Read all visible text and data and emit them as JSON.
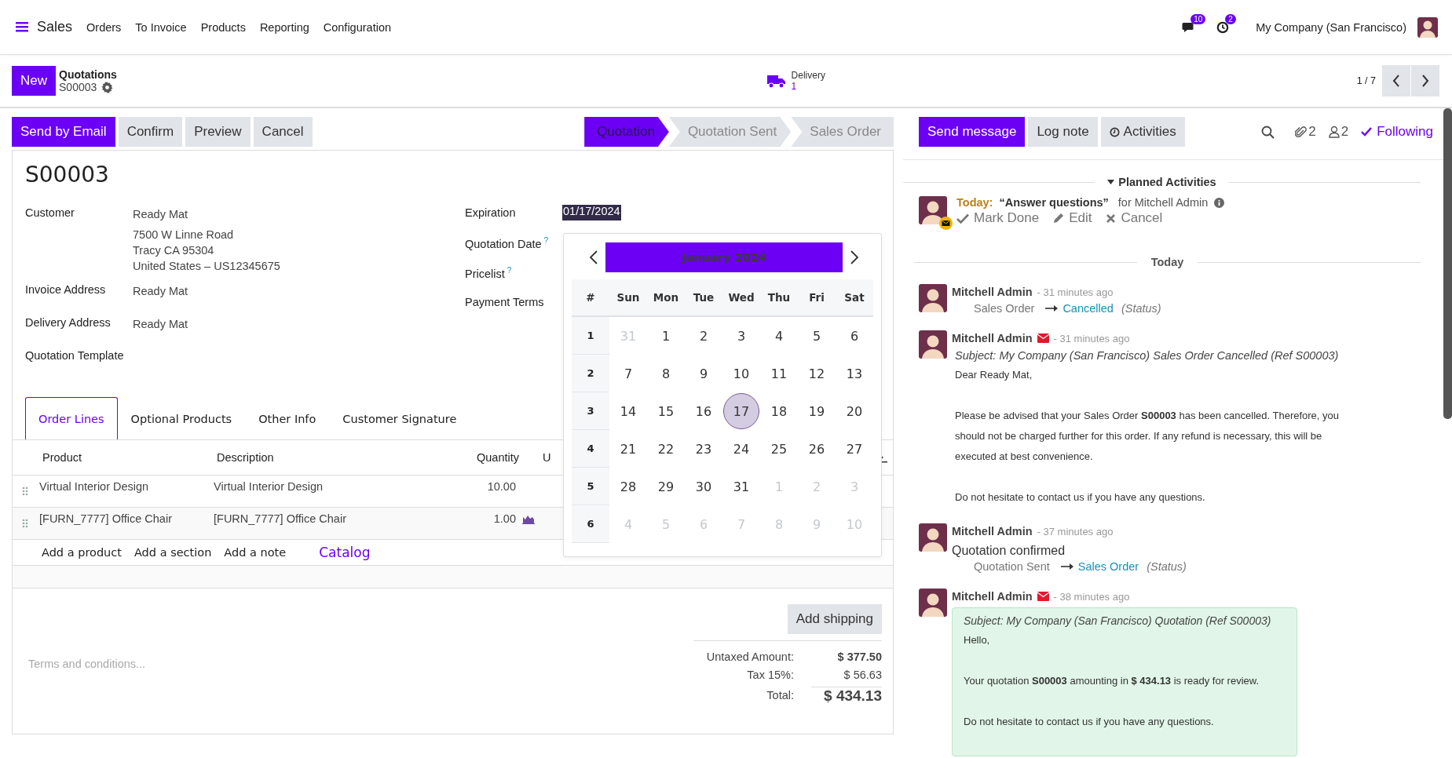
{
  "navbar": {
    "app": "Sales",
    "menu": [
      "Orders",
      "To Invoice",
      "Products",
      "Reporting",
      "Configuration"
    ],
    "messages_badge": "10",
    "activities_badge": "2",
    "company": "My Company (San Francisco)"
  },
  "control_panel": {
    "new_button": "New",
    "breadcrumb": "Quotations",
    "record": "S00003",
    "smart_button": {
      "label": "Delivery",
      "count": "1"
    },
    "pager": "1 / 7"
  },
  "actions": [
    {
      "label": "Send by Email",
      "primary": true
    },
    {
      "label": "Confirm",
      "primary": false
    },
    {
      "label": "Preview",
      "primary": false
    },
    {
      "label": "Cancel",
      "primary": false
    }
  ],
  "statusbar": [
    {
      "label": "Quotation",
      "selected": true
    },
    {
      "label": "Quotation Sent",
      "selected": false
    },
    {
      "label": "Sales Order",
      "selected": false
    }
  ],
  "form": {
    "title": "S00003",
    "left_fields": [
      {
        "label": "Customer",
        "lines": [
          "Ready Mat",
          "7500 W Linne Road",
          "Tracy CA 95304",
          "United States – US12345675"
        ]
      },
      {
        "label": "Invoice Address",
        "lines": [
          "Ready Mat"
        ]
      },
      {
        "label": "Delivery Address",
        "lines": [
          "Ready Mat"
        ]
      },
      {
        "label": "Quotation Template"
      }
    ],
    "right_fields": [
      {
        "label": "Expiration",
        "value": "01/17/2024"
      },
      {
        "label": "Quotation Date",
        "help": "?"
      },
      {
        "label": "Pricelist",
        "help": "?"
      },
      {
        "label": "Payment Terms"
      }
    ],
    "tabs": [
      {
        "label": "Order Lines",
        "selected": true
      },
      {
        "label": "Optional Products",
        "selected": false
      },
      {
        "label": "Other Info",
        "selected": false
      },
      {
        "label": "Customer Signature",
        "selected": false
      }
    ],
    "table": {
      "columns": [
        "Product",
        "Description",
        "Quantity",
        "U"
      ],
      "rows": [
        {
          "product": "Virtual Interior Design",
          "description": "Virtual Interior Design",
          "quantity": "10.00",
          "forecast": false
        },
        {
          "product": "[FURN_7777] Office Chair",
          "description": "[FURN_7777] Office Chair",
          "quantity": "1.00",
          "forecast": true
        }
      ],
      "add_links": [
        "Add a product",
        "Add a section",
        "Add a note"
      ],
      "catalog": "Catalog"
    },
    "terms_placeholder": "Terms and conditions...",
    "add_shipping": "Add shipping",
    "totals": [
      {
        "label": "Untaxed Amount:",
        "value": "$ 377.50",
        "kind": "bold"
      },
      {
        "label": "Tax 15%:",
        "value": "$ 56.63",
        "kind": "plain"
      },
      {
        "label": "Total:",
        "value": "$ 434.13",
        "kind": "grand"
      }
    ]
  },
  "datepicker": {
    "month": "January 2024",
    "weekdays": [
      "#",
      "Sun",
      "Mon",
      "Tue",
      "Wed",
      "Thu",
      "Fri",
      "Sat"
    ],
    "weeks": [
      {
        "number": "1",
        "days": [
          {
            "label": "31",
            "muted": true,
            "selected": false
          },
          {
            "label": "1",
            "muted": false,
            "selected": false
          },
          {
            "label": "2",
            "muted": false,
            "selected": false
          },
          {
            "label": "3",
            "muted": false,
            "selected": false
          },
          {
            "label": "4",
            "muted": false,
            "selected": false
          },
          {
            "label": "5",
            "muted": false,
            "selected": false
          },
          {
            "label": "6",
            "muted": false,
            "selected": false
          }
        ]
      },
      {
        "number": "2",
        "days": [
          {
            "label": "7",
            "muted": false,
            "selected": false
          },
          {
            "label": "8",
            "muted": false,
            "selected": false
          },
          {
            "label": "9",
            "muted": false,
            "selected": false
          },
          {
            "label": "10",
            "muted": false,
            "selected": false
          },
          {
            "label": "11",
            "muted": false,
            "selected": false
          },
          {
            "label": "12",
            "muted": false,
            "selected": false
          },
          {
            "label": "13",
            "muted": false,
            "selected": false
          }
        ]
      },
      {
        "number": "3",
        "days": [
          {
            "label": "14",
            "muted": false,
            "selected": false
          },
          {
            "label": "15",
            "muted": false,
            "selected": false
          },
          {
            "label": "16",
            "muted": false,
            "selected": false
          },
          {
            "label": "17",
            "muted": false,
            "selected": true
          },
          {
            "label": "18",
            "muted": false,
            "selected": false
          },
          {
            "label": "19",
            "muted": false,
            "selected": false
          },
          {
            "label": "20",
            "muted": false,
            "selected": false
          }
        ]
      },
      {
        "number": "4",
        "days": [
          {
            "label": "21",
            "muted": false,
            "selected": false
          },
          {
            "label": "22",
            "muted": false,
            "selected": false
          },
          {
            "label": "23",
            "muted": false,
            "selected": false
          },
          {
            "label": "24",
            "muted": false,
            "selected": false
          },
          {
            "label": "25",
            "muted": false,
            "selected": false
          },
          {
            "label": "26",
            "muted": false,
            "selected": false
          },
          {
            "label": "27",
            "muted": false,
            "selected": false
          }
        ]
      },
      {
        "number": "5",
        "days": [
          {
            "label": "28",
            "muted": false,
            "selected": false
          },
          {
            "label": "29",
            "muted": false,
            "selected": false
          },
          {
            "label": "30",
            "muted": false,
            "selected": false
          },
          {
            "label": "31",
            "muted": false,
            "selected": false
          },
          {
            "label": "1",
            "muted": true,
            "selected": false
          },
          {
            "label": "2",
            "muted": true,
            "selected": false
          },
          {
            "label": "3",
            "muted": true,
            "selected": false
          }
        ]
      },
      {
        "number": "6",
        "days": [
          {
            "label": "4",
            "muted": true,
            "selected": false
          },
          {
            "label": "5",
            "muted": true,
            "selected": false
          },
          {
            "label": "6",
            "muted": true,
            "selected": false
          },
          {
            "label": "7",
            "muted": true,
            "selected": false
          },
          {
            "label": "8",
            "muted": true,
            "selected": false
          },
          {
            "label": "9",
            "muted": true,
            "selected": false
          },
          {
            "label": "10",
            "muted": true,
            "selected": false
          }
        ]
      }
    ]
  },
  "chatter": {
    "buttons": [
      {
        "label": "Send message",
        "primary": true
      },
      {
        "label": "Log note",
        "primary": false
      },
      {
        "label": "Activities",
        "primary": false
      }
    ],
    "attachments": "2",
    "followers": "2",
    "follow": "Following",
    "planned_header": "Planned Activities",
    "activity": {
      "due": "Today:",
      "summary": "“Answer questions”",
      "assignee": "for Mitchell Admin",
      "actions": [
        {
          "label": "Mark Done",
          "kind": "done"
        },
        {
          "label": "Edit",
          "kind": "edit"
        },
        {
          "label": "Cancel",
          "kind": "cancel"
        }
      ]
    },
    "date_separator": "Today",
    "messages": [
      {
        "author": "Mitchell Admin",
        "email": false,
        "time": "- 31 minutes ago",
        "tracking": {
          "old": "Sales Order",
          "new": "Cancelled",
          "field": "(Status)"
        }
      },
      {
        "author": "Mitchell Admin",
        "email": true,
        "time": "- 31 minutes ago",
        "subject": "Subject: My Company (San Francisco) Sales Order Cancelled (Ref S00003)",
        "bubble": false,
        "paragraphs": [
          "Dear Ready Mat,",
          "Please be advised that your Sales Order **S00003** has been cancelled. Therefore, you should not be charged further for this order. If any refund is necessary, this will be executed at best convenience.",
          "Do not hesitate to contact us if you have any questions."
        ]
      },
      {
        "author": "Mitchell Admin",
        "email": false,
        "time": "- 37 minutes ago",
        "body": "Quotation confirmed",
        "tracking": {
          "old": "Quotation Sent",
          "new": "Sales Order",
          "field": "(Status)"
        }
      },
      {
        "author": "Mitchell Admin",
        "email": true,
        "time": "- 38 minutes ago",
        "subject": "Subject: My Company (San Francisco) Quotation (Ref S00003)",
        "bubble": true,
        "paragraphs": [
          "Hello,",
          "Your quotation **S00003** amounting in **$ 434.13** is ready for review.",
          "Do not hesitate to contact us if you have any questions."
        ]
      }
    ]
  }
}
